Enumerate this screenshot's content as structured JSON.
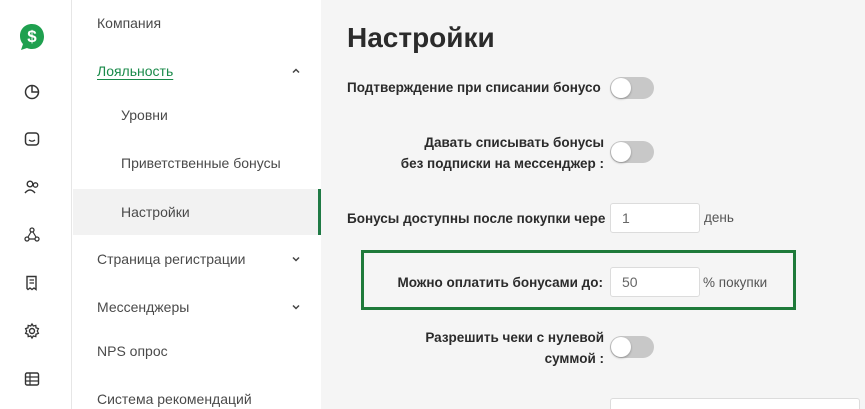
{
  "rail": {
    "icons": [
      "dollar-logo-icon",
      "pie-chart-icon",
      "chat-face-icon",
      "users-icon",
      "network-icon",
      "receipt-icon",
      "gear-icon",
      "table-icon"
    ],
    "accent": "#1fa04f"
  },
  "submenu": {
    "items": [
      {
        "label": "Компания"
      },
      {
        "label": "Лояльность"
      },
      {
        "label": "Уровни"
      },
      {
        "label": "Приветственные бонусы"
      },
      {
        "label": "Настройки"
      },
      {
        "label": "Страница регистрации"
      },
      {
        "label": "Мессенджеры"
      },
      {
        "label": "NPS опрос"
      },
      {
        "label": "Система рекомендаций"
      }
    ]
  },
  "main": {
    "title": "Настройки",
    "confirm_label": "Подтверждение при списании бонусо",
    "allow_label_line1": "Давать списывать бонусы",
    "allow_label_line2": "без подписки на мессенджер :",
    "available_label": "Бонусы доступны после покупки чере",
    "available_value": "1",
    "available_suffix": "день",
    "pay_label": "Можно оплатить бонусами до:",
    "pay_value": "50",
    "pay_suffix": "% покупки",
    "zero_label_line1": "Разрешить чеки с нулевой",
    "zero_label_line2": "суммой :"
  }
}
